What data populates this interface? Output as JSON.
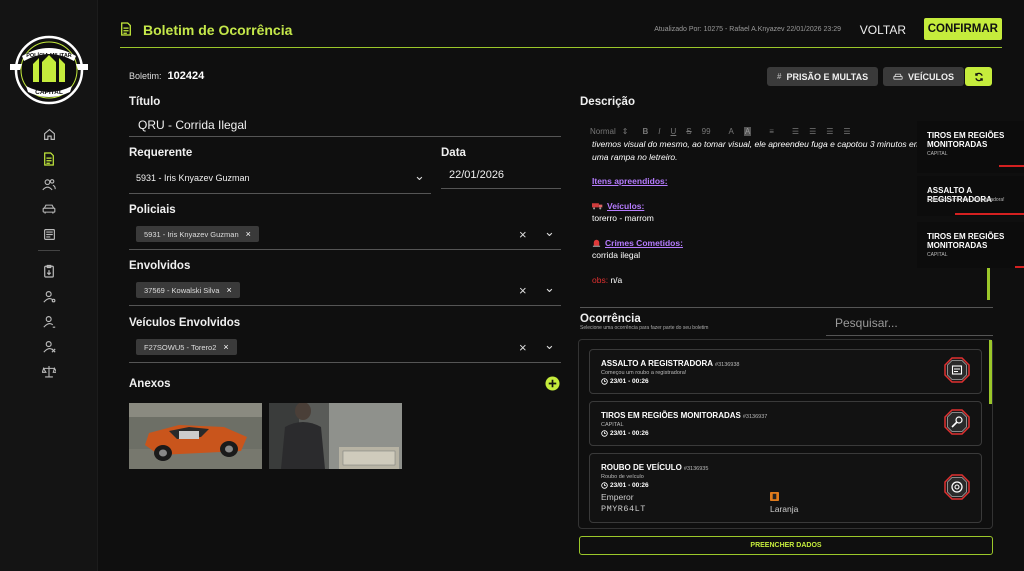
{
  "header": {
    "title": "Boletim de Ocorrência",
    "updated": "Atualizado Por: 10275 - Rafael A.Knyazev 22/01/2026 23:29",
    "back_label": "VOLTAR",
    "confirm_label": "CONFIRMAR",
    "accent": "#c5ec3c"
  },
  "logo": {
    "top": "POLÍCIA MILITAR",
    "bottom": "CAPITAL"
  },
  "sidebar": {
    "items": [
      {
        "icon": "home-icon"
      },
      {
        "icon": "document-icon",
        "active": true
      },
      {
        "icon": "users-icon"
      },
      {
        "icon": "car-icon"
      },
      {
        "icon": "newspaper-icon"
      },
      {
        "icon": "clipboard-icon"
      },
      {
        "icon": "user-settings-icon"
      },
      {
        "icon": "user-search-icon"
      },
      {
        "icon": "user-x-icon"
      },
      {
        "icon": "scale-icon"
      }
    ]
  },
  "form": {
    "boletim_label": "Boletim:",
    "boletim_number": "102424",
    "titulo_label": "Título",
    "titulo_value": "QRU - Corrida Ilegal",
    "requerente_label": "Requerente",
    "requerente_value": "5931 - Iris Knyazev Guzman",
    "data_label": "Data",
    "data_value": "22/01/2026",
    "policiais_label": "Policiais",
    "policiais_tag": "5931 - Iris Knyazev Guzman",
    "envolvidos_label": "Envolvidos",
    "envolvidos_tag": "37569 - Kowalski Silva",
    "veiculos_label": "Veículos Envolvidos",
    "veiculos_tag": "F27SOWU5 - Torero2",
    "anexos_label": "Anexos",
    "tag_close": "×",
    "clear": "×",
    "chevron": "⌄"
  },
  "buttons": {
    "prisao": "PRISÃO E MULTAS",
    "veiculos": "VEÍCULOS",
    "fill": "PREENCHER DADOS"
  },
  "descricao": {
    "label": "Descrição",
    "toolbar": [
      "Normal",
      "B",
      "I",
      "U",
      "S",
      "99",
      "A",
      "A"
    ],
    "line1": "tivemos visual do mesmo, ao tomar visual, ele apreendeu fuga e capotou 3 minutos em",
    "line2": "uma rampa no letreiro.",
    "itens": "Itens apreendidos:",
    "veiculos_heading": "Veículos:",
    "veiculos_value": "torerro - marrom",
    "crimes_heading": "Crimes Cometidos:",
    "crimes_value": "corrida ilegal",
    "obs_label": "obs:",
    "obs_value": "n/a"
  },
  "notifications": [
    {
      "title": "TIROS EM REGIÕES MONITORADAS",
      "sub": "CAPITAL"
    },
    {
      "title": "ASSALTO A REGISTRADORA",
      "sub": "Começou um roubo a registradora!"
    },
    {
      "title": "TIROS EM REGIÕES MONITORADAS",
      "sub": "CAPITAL"
    }
  ],
  "ocorrencia": {
    "title": "Ocorrência",
    "subtitle": "Selecione uma ocorrência para fazer parte do seu boletim",
    "search_placeholder": "Pesquisar...",
    "cards": [
      {
        "title": "ASSALTO A REGISTRADORA",
        "id": "#3136938",
        "sub": "Começou um roubo a registradora!",
        "date": "23/01 - 00:26",
        "icon": "cash-register-icon"
      },
      {
        "title": "TIROS EM REGIÕES MONITORADAS",
        "id": "#3136937",
        "sub": "CAPITAL",
        "date": "23/01 - 00:26",
        "icon": "gun-icon"
      },
      {
        "title": "ROUBO DE VEÍCULO",
        "id": "#3136935",
        "sub": "Roubo de veículo",
        "date": "23/01 - 00:26",
        "icon": "wheel-icon",
        "model": "Emperor",
        "plate": "PMYR64LT",
        "color": "Laranja"
      }
    ]
  }
}
